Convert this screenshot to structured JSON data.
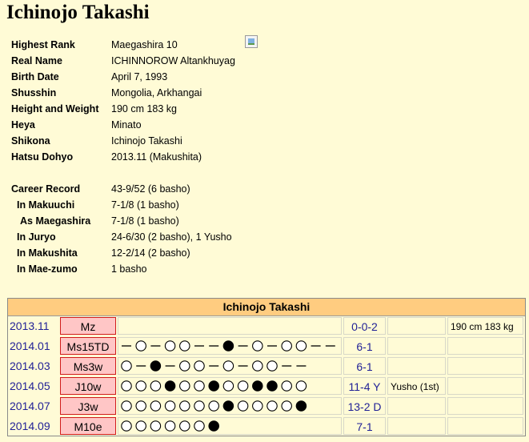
{
  "page": {
    "title": "Ichinojo Takashi"
  },
  "profile": {
    "highest_rank": {
      "label": "Highest Rank",
      "value": "Maegashira 10"
    },
    "real_name": {
      "label": "Real Name",
      "value": "ICHINNOROW Altankhuyag"
    },
    "birth_date": {
      "label": "Birth Date",
      "value": "April 7, 1993"
    },
    "shusshin": {
      "label": "Shusshin",
      "value": "Mongolia, Arkhangai"
    },
    "height_weight": {
      "label": "Height and Weight",
      "value": "190 cm 183 kg"
    },
    "heya": {
      "label": "Heya",
      "value": "Minato"
    },
    "shikona": {
      "label": "Shikona",
      "value": "Ichinojo Takashi"
    },
    "hatsu_dohyo": {
      "label": "Hatsu Dohyo",
      "value": "2013.11 (Makushita)"
    }
  },
  "career": {
    "record": {
      "label": "Career Record",
      "value": "43-9/52 (6 basho)"
    },
    "makuuchi": {
      "label": "In Makuuchi",
      "value": "7-1/8 (1 basho)"
    },
    "maegashira": {
      "label": "As Maegashira",
      "value": "7-1/8 (1 basho)"
    },
    "juryo": {
      "label": "In Juryo",
      "value": "24-6/30 (2 basho), 1 Yusho"
    },
    "makushita": {
      "label": "In Makushita",
      "value": "12-2/14 (2 basho)"
    },
    "maezumo": {
      "label": "In Mae-zumo",
      "value": "1 basho"
    }
  },
  "basho_table": {
    "title": "Ichinojo Takashi",
    "rows": [
      {
        "date": "2013.11",
        "rank": "Mz",
        "results": "",
        "record": "0-0-2",
        "prize": "",
        "extra": "190 cm 183 kg"
      },
      {
        "date": "2014.01",
        "rank": "Ms15TD",
        "results": "-o-oo--x-o-oo--",
        "record": "6-1",
        "prize": "",
        "extra": ""
      },
      {
        "date": "2014.03",
        "rank": "Ms3w",
        "results": "o-x-oo-o-oo--",
        "record": "6-1",
        "prize": "",
        "extra": ""
      },
      {
        "date": "2014.05",
        "rank": "J10w",
        "results": "oooxooxooxxoo",
        "record": "11-4 Y",
        "prize": "Yusho (1st)",
        "extra": ""
      },
      {
        "date": "2014.07",
        "rank": "J3w",
        "results": "oooooooxoooox",
        "record": "13-2 D",
        "prize": "",
        "extra": ""
      },
      {
        "date": "2014.09",
        "rank": "M10e",
        "results": "oooooox",
        "record": "7-1",
        "prize": "",
        "extra": ""
      }
    ]
  }
}
